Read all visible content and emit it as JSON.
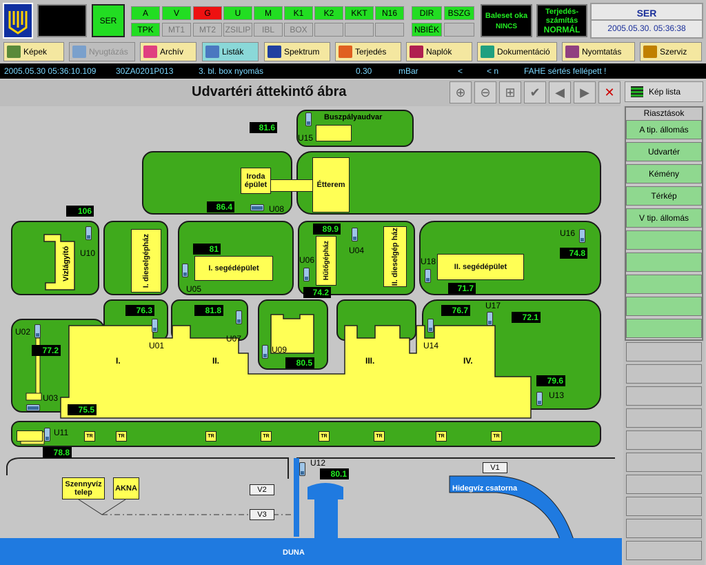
{
  "header": {
    "ser_short": "SER",
    "signals_row1": [
      "A",
      "V",
      "G",
      "U",
      "M",
      "K1",
      "K2",
      "KKT",
      "N16"
    ],
    "signals_row2": [
      "TPK",
      "MT1",
      "MT2",
      "ZSILIP",
      "IBL",
      "BOX",
      "",
      "",
      ""
    ],
    "dir": "DIR",
    "bszg": "BSZG",
    "nbiek": "NBIÉK",
    "accident_line1": "Baleset oka",
    "accident_line2": "NINCS",
    "spread_line1": "Terjedés-",
    "spread_line2": "számítás",
    "spread_line3": "NORMÁL",
    "ser": "SER",
    "datetime": "2005.05.30. 05:36:38",
    "colors": {
      "ok": "#22dd22",
      "alarm": "#ee1111",
      "inactive": "#bdbdbd"
    }
  },
  "menu": [
    {
      "label": "Képek",
      "icon": "images-icon"
    },
    {
      "label": "Nyugtázás",
      "icon": "acknowledge-icon"
    },
    {
      "label": "Archív",
      "icon": "archive-icon"
    },
    {
      "label": "Listák",
      "icon": "list-icon"
    },
    {
      "label": "Spektrum",
      "icon": "spectrum-icon"
    },
    {
      "label": "Terjedés",
      "icon": "spread-icon"
    },
    {
      "label": "Naplók",
      "icon": "log-icon"
    },
    {
      "label": "Dokumentáció",
      "icon": "help-icon"
    },
    {
      "label": "Nyomtatás",
      "icon": "printer-icon"
    },
    {
      "label": "Szerviz",
      "icon": "tools-icon"
    }
  ],
  "alarm": {
    "time": "2005.05.30 05:36:10.109",
    "code": "30ZA0201P013",
    "desc": "3. bl. box nyomás",
    "value": "0.30",
    "unit": "mBar",
    "cmp1": "<",
    "cmp2": "< n",
    "msg": "FAHE sértés fellépett !"
  },
  "page_title": "Udvartéri áttekintő ábra",
  "kep_lista": "Kép lista",
  "sidebar": {
    "heading": "Riasztások",
    "items": [
      "A tip. állomás",
      "Udvartér",
      "Kémény",
      "Térkép",
      "V tip. állomás"
    ]
  },
  "map": {
    "buildings": {
      "buszpalya": "Buszpályaudvar",
      "iroda": "Iroda épület",
      "etterem": "Étterem",
      "vizlagyito": "Vízlágyító",
      "diesel1": "I. dieselgépház",
      "seged1": "I. segédépület",
      "hutogep": "Hűtőgépház",
      "diesel2": "II. dieselgép ház",
      "seged2": "II. segédépület",
      "szennyviz": "Szennyvíz telep",
      "akna": "AKNA",
      "hidegviz": "Hidegvíz csatorna",
      "duna": "DUNA"
    },
    "values": {
      "v816": "81.6",
      "v864": "86.4",
      "v106": "106",
      "v81": "81",
      "v899": "89.9",
      "v742": "74.2",
      "v748": "74.8",
      "v717": "71.7",
      "v763": "76.3",
      "v818": "81.8",
      "v805": "80.5",
      "v767": "76.7",
      "v721": "72.1",
      "v772": "77.2",
      "v755": "75.5",
      "v796": "79.6",
      "v788": "78.8",
      "v801": "80.1"
    },
    "stations": {
      "U01": "U01",
      "U02": "U02",
      "U03": "U03",
      "U04": "U04",
      "U05": "U05",
      "U06": "U06",
      "U07": "U07",
      "U08": "U08",
      "U09": "U09",
      "U10": "U10",
      "U11": "U11",
      "U12": "U12",
      "U13": "U13",
      "U14": "U14",
      "U15": "U15",
      "U16": "U16",
      "U17": "U17",
      "U18": "U18"
    },
    "blocks": [
      "I.",
      "II.",
      "III.",
      "IV."
    ],
    "tr": "TR",
    "valves": {
      "v1": "V1",
      "v2": "V2",
      "v3": "V3"
    }
  }
}
